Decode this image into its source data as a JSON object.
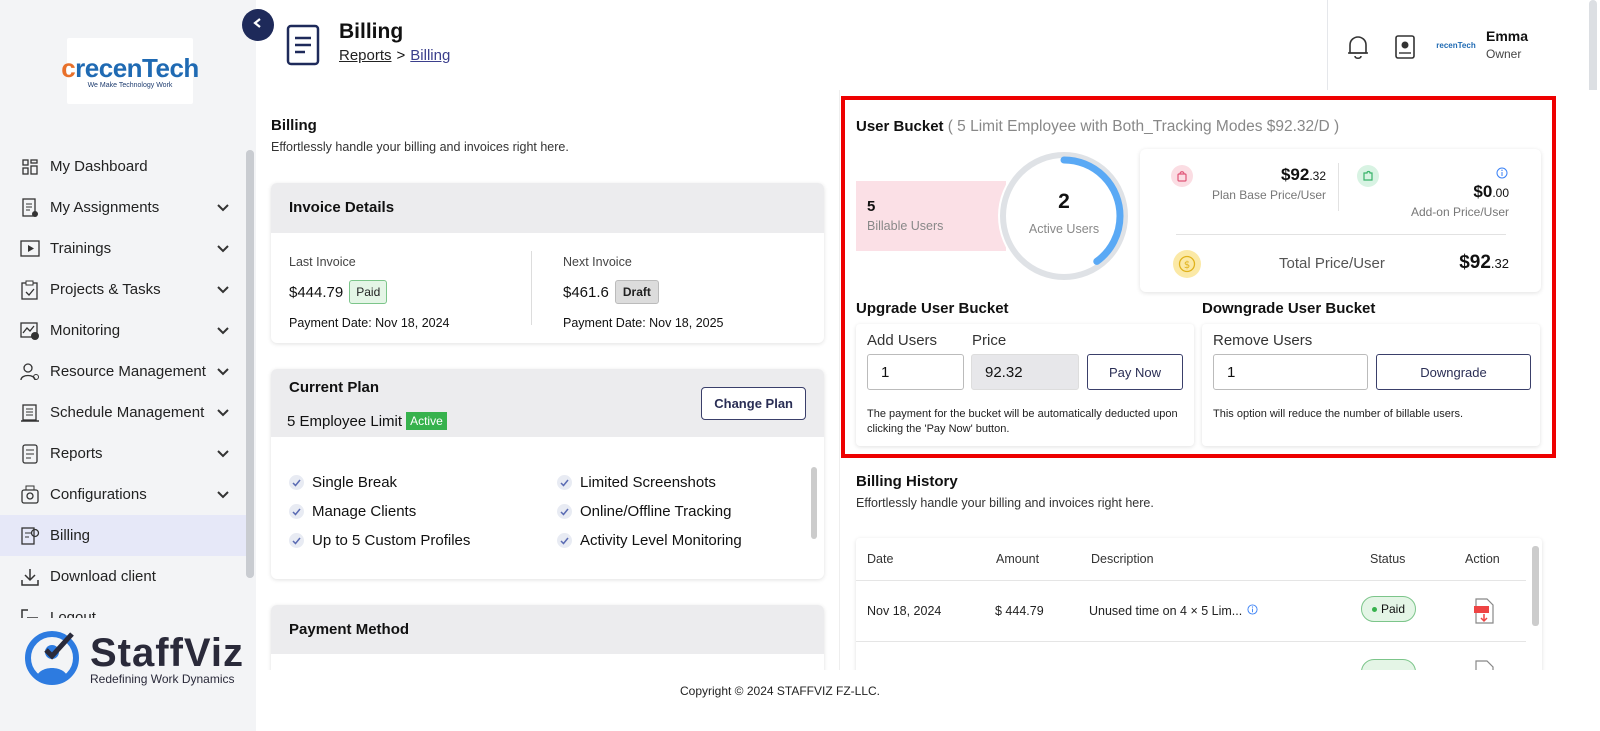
{
  "brand": {
    "top_logo_prefix": "c",
    "top_logo_text": "recenTech",
    "top_logo_tagline": "We Make Technology Work",
    "bottom_logo_name": "StaffViz",
    "bottom_logo_tagline": "Redefining Work Dynamics",
    "avatar_text": "recenTech"
  },
  "sidebar": {
    "items": [
      {
        "label": "My Dashboard",
        "icon": "dashboard-grid-icon",
        "expandable": false
      },
      {
        "label": "My Assignments",
        "icon": "assignment-icon",
        "expandable": true
      },
      {
        "label": "Trainings",
        "icon": "play-icon",
        "expandable": true
      },
      {
        "label": "Projects & Tasks",
        "icon": "clipboard-check-icon",
        "expandable": true
      },
      {
        "label": "Monitoring",
        "icon": "monitoring-icon",
        "expandable": true
      },
      {
        "label": "Resource Management",
        "icon": "user-gear-icon",
        "expandable": true
      },
      {
        "label": "Schedule Management",
        "icon": "schedule-building-icon",
        "expandable": true
      },
      {
        "label": "Reports",
        "icon": "report-doc-icon",
        "expandable": true
      },
      {
        "label": "Configurations",
        "icon": "config-icon",
        "expandable": true
      },
      {
        "label": "Billing",
        "icon": "billing-icon",
        "expandable": false,
        "active": true
      },
      {
        "label": "Download client",
        "icon": "download-icon",
        "expandable": false
      },
      {
        "label": "Logout",
        "icon": "logout-icon",
        "expandable": false
      }
    ]
  },
  "header": {
    "title": "Billing",
    "breadcrumb_1": "Reports",
    "breadcrumb_sep": ">",
    "breadcrumb_2": "Billing",
    "user_name": "Emma",
    "user_role": "Owner"
  },
  "billing": {
    "title": "Billing",
    "subtitle": "Effortlessly handle your billing and invoices right here."
  },
  "invoice": {
    "title": "Invoice Details",
    "last_label": "Last Invoice",
    "last_amount": "$444.79",
    "last_status": "Paid",
    "last_date": "Payment Date: Nov 18, 2024",
    "next_label": "Next Invoice",
    "next_amount": "$461.6",
    "next_status": "Draft",
    "next_date": "Payment Date: Nov 18, 2025"
  },
  "plan": {
    "title": "Current Plan",
    "limit": "5 Employee Limit",
    "status": "Active",
    "change_label": "Change Plan",
    "features": [
      "Single Break",
      "Limited Screenshots",
      "Manage Clients",
      "Online/Offline Tracking",
      "Up to 5 Custom Profiles",
      "Activity Level Monitoring"
    ]
  },
  "payment": {
    "title": "Payment Method"
  },
  "bucket": {
    "title": "User Bucket",
    "desc": "( 5 Limit Employee with Both_Tracking Modes $92.32/D )",
    "billable_count": "5",
    "billable_label": "Billable Users",
    "active_count": "2",
    "active_label": "Active Users",
    "active_ratio": 0.4,
    "base_price_main": "$92",
    "base_price_cents": ".32",
    "base_price_label": "Plan Base Price/User",
    "addon_price_main": "$0",
    "addon_price_cents": ".00",
    "addon_price_label": "Add-on Price/User",
    "total_label": "Total Price/User",
    "total_main": "$92",
    "total_cents": ".32"
  },
  "upgrade": {
    "title": "Upgrade User Bucket",
    "add_label": "Add Users",
    "add_value": "1",
    "price_label": "Price",
    "price_value": "92.32",
    "pay_label": "Pay Now",
    "note": "The payment for the bucket will be automatically deducted upon clicking the 'Pay Now' button."
  },
  "downgrade": {
    "title": "Downgrade User Bucket",
    "remove_label": "Remove Users",
    "remove_value": "1",
    "button_label": "Downgrade",
    "note": "This option will reduce the number of billable users."
  },
  "history": {
    "title": "Billing History",
    "subtitle": "Effortlessly handle your billing and invoices right here.",
    "columns": [
      "Date",
      "Amount",
      "Description",
      "Status",
      "Action"
    ],
    "rows": [
      {
        "date": "Nov 18, 2024",
        "amount": "$ 444.79",
        "description": "Unused time on 4 × 5 Lim...",
        "status": "Paid"
      }
    ]
  },
  "footer": {
    "copyright": "Copyright © 2024 STAFFVIZ FZ-LLC."
  },
  "colors": {
    "accent": "#1e2a5a",
    "active_green": "#37b24d",
    "highlight_red": "#e00000",
    "gauge_blue": "#5aa9f5"
  }
}
